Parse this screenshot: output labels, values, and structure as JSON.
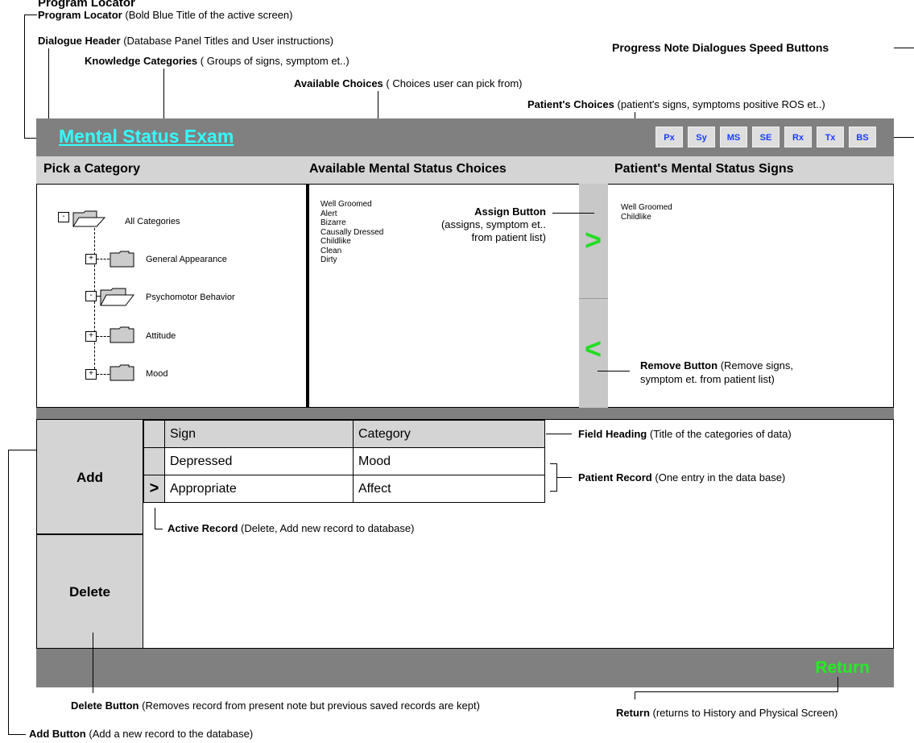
{
  "annotations": {
    "program_locator": {
      "title": "Program Locator",
      "desc": "(Bold Blue Title of the active screen)"
    },
    "dialogue_header": {
      "title": "Dialogue Header",
      "desc": "(Database Panel Titles and User instructions)"
    },
    "knowledge_categories": {
      "title": "Knowledge Categories",
      "desc": "( Groups of signs, symptom et..)"
    },
    "available_choices": {
      "title": "Available Choices",
      "desc": "( Choices user can pick from)"
    },
    "speed_buttons": {
      "title": "Progress Note Dialogues Speed Buttons"
    },
    "patients_choices": {
      "title": "Patient's Choices",
      "desc": "(patient's signs, symptoms positive ROS et..)"
    },
    "assign_button": {
      "title": "Assign Button",
      "line1": "(assigns, symptom et..",
      "line2": "from patient list)"
    },
    "remove_button": {
      "title": "Remove Button",
      "desc": "(Remove signs,",
      "line2": "symptom et. from patient list)"
    },
    "field_heading": {
      "title": "Field Heading",
      "desc": "(Title of the categories of data)"
    },
    "patient_record": {
      "title": "Patient Record",
      "desc": "(One entry in the data base)"
    },
    "active_record": {
      "title": "Active Record",
      "desc": "(Delete, Add new record to database)"
    },
    "delete_button": {
      "title": "Delete Button",
      "desc": "(Removes record from present note but previous saved records are kept)"
    },
    "return_button": {
      "title": "Return",
      "desc": "(returns to History and Physical Screen)"
    },
    "add_button": {
      "title": "Add Button",
      "desc": "(Add a new record to the database)"
    }
  },
  "screen": {
    "title": "Mental Status Exam",
    "speed_buttons": [
      "Px",
      "Sy",
      "MS",
      "SE",
      "Rx",
      "Tx",
      "BS"
    ],
    "headers": {
      "categories": "Pick a Category",
      "available": "Available Mental Status Choices",
      "patient": "Patient's Mental Status Signs"
    },
    "tree": {
      "root": {
        "label": "All Categories",
        "toggle": "-"
      },
      "children": [
        {
          "label": "General Appearance",
          "toggle": "+"
        },
        {
          "label": "Psychomotor Behavior",
          "toggle": "-"
        },
        {
          "label": "Attitude",
          "toggle": "+"
        },
        {
          "label": "Mood",
          "toggle": "+"
        }
      ]
    },
    "available_choices": [
      "Well Groomed",
      "Alert",
      "Bizarre",
      "Causally Dressed",
      "Childlike",
      "Clean",
      "Dirty"
    ],
    "patient_signs": [
      "Well Groomed",
      "Childlike"
    ],
    "assign_symbol": ">",
    "remove_symbol": "<",
    "add_label": "Add",
    "delete_label": "Delete",
    "table": {
      "headers": [
        "Sign",
        "Category"
      ],
      "rows": [
        {
          "marker": "",
          "sign": "Depressed",
          "category": "Mood"
        },
        {
          "marker": ">",
          "sign": "Appropriate",
          "category": "Affect"
        }
      ]
    },
    "return_label": "Return"
  },
  "colors": {
    "title_cyan": "#33ffff",
    "bar_gray": "#808080",
    "panel_gray": "#d4d4d4",
    "speed_blue": "#1a3cff",
    "arrow_green": "#22dd22"
  }
}
